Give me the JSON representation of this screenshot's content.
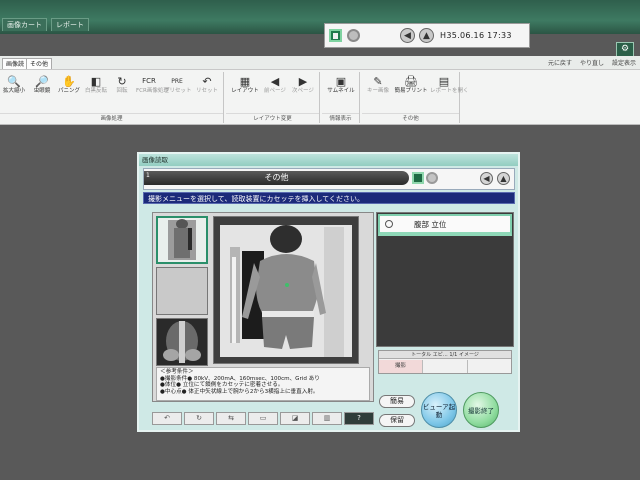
{
  "app_tabs": [
    "画像カート",
    "レポート"
  ],
  "system": {
    "datetime": "H35.06.16 17:33"
  },
  "menu": {
    "tabs": [
      "画像読",
      "その他"
    ],
    "right_items": [
      "元に戻す",
      "やり直し",
      "設定表示"
    ]
  },
  "ribbon": {
    "groups": [
      {
        "label": "画像処理",
        "buttons": [
          "拡大縮小",
          "虫眼鏡",
          "パニング",
          "白黒反転",
          "回転",
          "FCR画像処理",
          "プリセット",
          "リセット"
        ]
      },
      {
        "label": "レイアウト変更",
        "buttons": [
          "レイアウト",
          "前ページ",
          "次ページ"
        ]
      },
      {
        "label": "情報表示",
        "buttons": [
          "サムネイル"
        ]
      },
      {
        "label": "その他",
        "buttons": [
          "キー画像",
          "簡易プリント",
          "レポートを開く"
        ]
      }
    ]
  },
  "dialog": {
    "title": "画像読取",
    "index": "1",
    "header": "その他",
    "message": "撮影メニューを選択して、読取装置にカセッテを挿入してください。",
    "notes": [
      "＜参考条件＞",
      "●撮影条件●  80kV、200mA、160msec、100cm、Grid あり",
      "●体位●  立位にて鎖側をカセッテに密着させる。",
      "●中心点●  体正中矢状線上で腕から2から3横指上に垂直入射。"
    ],
    "exam_label": "腹部  立位",
    "counter": {
      "header": "トータル  エピ…  1/1 イメージ",
      "cell": "撮影"
    },
    "buttons": {
      "simple": "簡易",
      "hold": "保留",
      "viewer": "ビューア起動",
      "end": "撮影終了"
    }
  },
  "colors": {
    "accent": "#3e7a62",
    "message_bg": "#1c2a7a",
    "exam_border": "#7fcfae"
  }
}
